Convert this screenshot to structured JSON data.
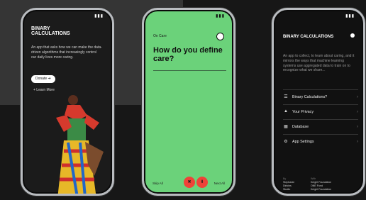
{
  "phone_left": {
    "app_title": "BINARY CALCULATIONS",
    "description": "An app that asks how we can make the data-driven algorithms that increasingly control our daily lives more caring.",
    "primary_button": "Donate ➔",
    "secondary_link": "+ Learn More"
  },
  "phone_center": {
    "back_label": "On Care",
    "question": "How do you define care?",
    "skip_label": "Skip All",
    "next_label": "Next All",
    "circle_left": "✖",
    "circle_right": "⬇"
  },
  "phone_right": {
    "app_title": "BINARY CALCULATIONS",
    "description": "An app to collect, to learn about caring, and it mirrors the ways that machine learning systems use aggregated data to train on to recognize what we share...",
    "menu": [
      {
        "icon": "list-icon",
        "label": "Binary Calculations?"
      },
      {
        "icon": "shield-icon",
        "label": "Your Privacy"
      },
      {
        "icon": "database-icon",
        "label": "Database"
      },
      {
        "icon": "gear-icon",
        "label": "App Settings"
      }
    ],
    "footer_left": [
      "By",
      "Stephanie",
      "Dinkins",
      "Studio"
    ],
    "footer_right": [
      "With",
      "Knight Foundation",
      "ONE Fund",
      "Knight Foundation"
    ]
  },
  "colors": {
    "green": "#6bd27a",
    "red": "#ef4338",
    "dark": "#111111"
  }
}
